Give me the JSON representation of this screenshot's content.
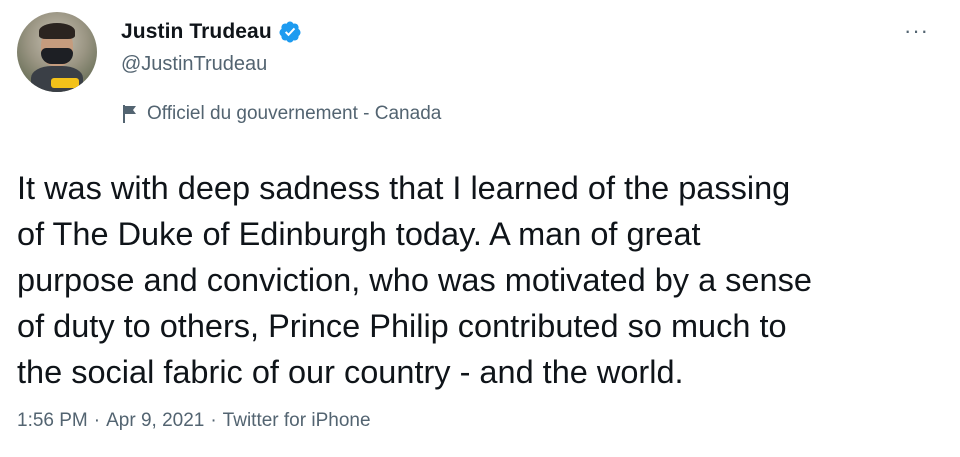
{
  "tweet": {
    "author": {
      "display_name": "Justin Trudeau",
      "handle": "@JustinTrudeau",
      "verified": true,
      "verified_icon": "verified-badge-icon",
      "label": "Officiel du gouvernement - Canada",
      "label_icon": "flag-icon"
    },
    "more_icon": "more-options-icon",
    "more_label": "···",
    "body": "It was with deep sadness that I learned of the passing\nof The Duke of Edinburgh today. A man of great\npurpose and conviction, who was motivated by a sense\nof duty to others, Prince Philip contributed so much to\nthe social fabric of our country - and the world.",
    "time": "1:56 PM",
    "date": "Apr 9, 2021",
    "separator": "·",
    "source": "Twitter for iPhone"
  },
  "colors": {
    "text": "#0f1419",
    "secondary_text": "#536471",
    "verified": "#1d9bf0",
    "background": "#ffffff"
  }
}
